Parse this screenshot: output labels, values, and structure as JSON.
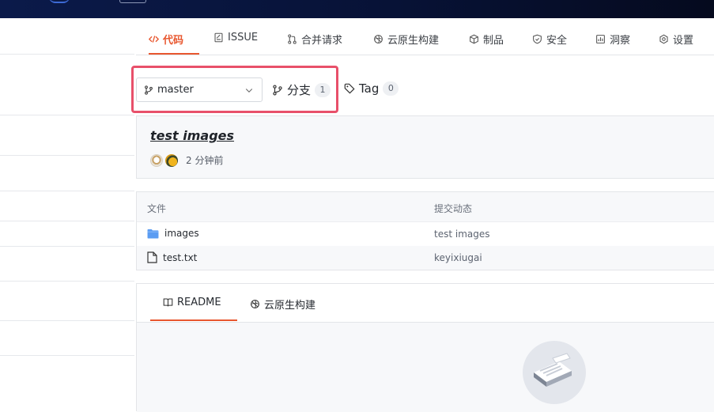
{
  "nav": {
    "items": [
      {
        "label": "代码",
        "icon": "code-icon",
        "active": true
      },
      {
        "label": "ISSUE",
        "icon": "issue-icon"
      },
      {
        "label": "合并请求",
        "icon": "merge-icon"
      },
      {
        "label": "云原生构建",
        "icon": "cloud-build-icon"
      },
      {
        "label": "制品",
        "icon": "package-icon"
      },
      {
        "label": "安全",
        "icon": "shield-icon"
      },
      {
        "label": "洞察",
        "icon": "insight-icon"
      },
      {
        "label": "设置",
        "icon": "gear-icon"
      }
    ]
  },
  "branch": {
    "current": "master",
    "branches_label": "分支",
    "branches_count": "1",
    "tags_label": "Tag",
    "tags_count": "0"
  },
  "commit": {
    "title": "test images",
    "time": "2 分钟前"
  },
  "files": {
    "col_file": "文件",
    "col_commit": "提交动态",
    "rows": [
      {
        "name": "images",
        "type": "folder",
        "message": "test images"
      },
      {
        "name": "test.txt",
        "type": "file",
        "message": "keyixiugai"
      }
    ]
  },
  "readme": {
    "tabs": [
      {
        "label": "README",
        "icon": "book-icon",
        "active": true
      },
      {
        "label": "云原生构建",
        "icon": "cloud-build-icon"
      }
    ]
  },
  "colors": {
    "accent": "#e8572f",
    "highlight": "#e8506a",
    "topbar": "#071236"
  }
}
